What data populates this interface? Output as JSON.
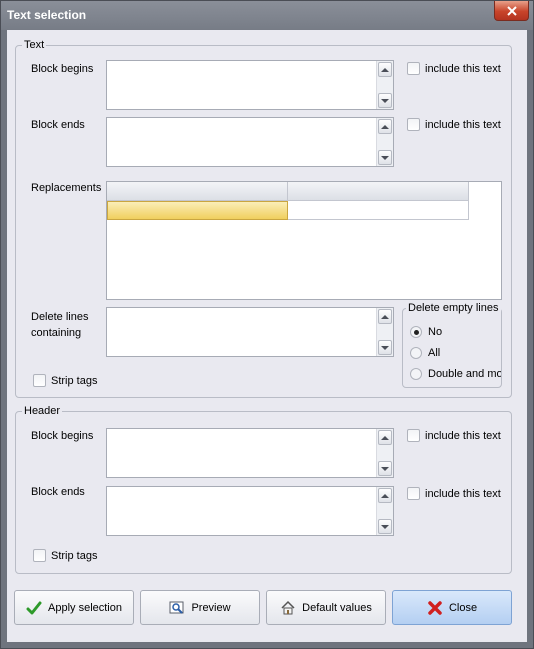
{
  "window": {
    "title": "Text selection"
  },
  "text_group": {
    "legend": "Text",
    "block_begins_label": "Block begins",
    "block_ends_label": "Block ends",
    "include_label_1": "include this text",
    "include_label_2": "include this text",
    "replacements_label": "Replacements",
    "delete_lines_label_1": "Delete lines",
    "delete_lines_label_2": "containing",
    "strip_tags_label": "Strip tags",
    "delete_empty": {
      "legend": "Delete empty lines",
      "options": [
        "No",
        "All",
        "Double and mor"
      ],
      "selected": "No"
    }
  },
  "header_group": {
    "legend": "Header",
    "block_begins_label": "Block begins",
    "block_ends_label": "Block ends",
    "include_label_1": "include this text",
    "include_label_2": "include this text",
    "strip_tags_label": "Strip tags"
  },
  "buttons": {
    "apply": "Apply selection",
    "preview": "Preview",
    "defaults": "Default values",
    "close": "Close"
  },
  "icons": {
    "apply": "check-icon",
    "preview": "magnifier-icon",
    "defaults": "home-icon",
    "close": "red-x-icon",
    "window_close": "close-icon"
  },
  "colors": {
    "titlebar": "#80858f",
    "client": "#e9e9f0",
    "close_button": "#c8442a",
    "selected_cell": "#f2d675",
    "close_btn_bg": "#b4cff2"
  }
}
